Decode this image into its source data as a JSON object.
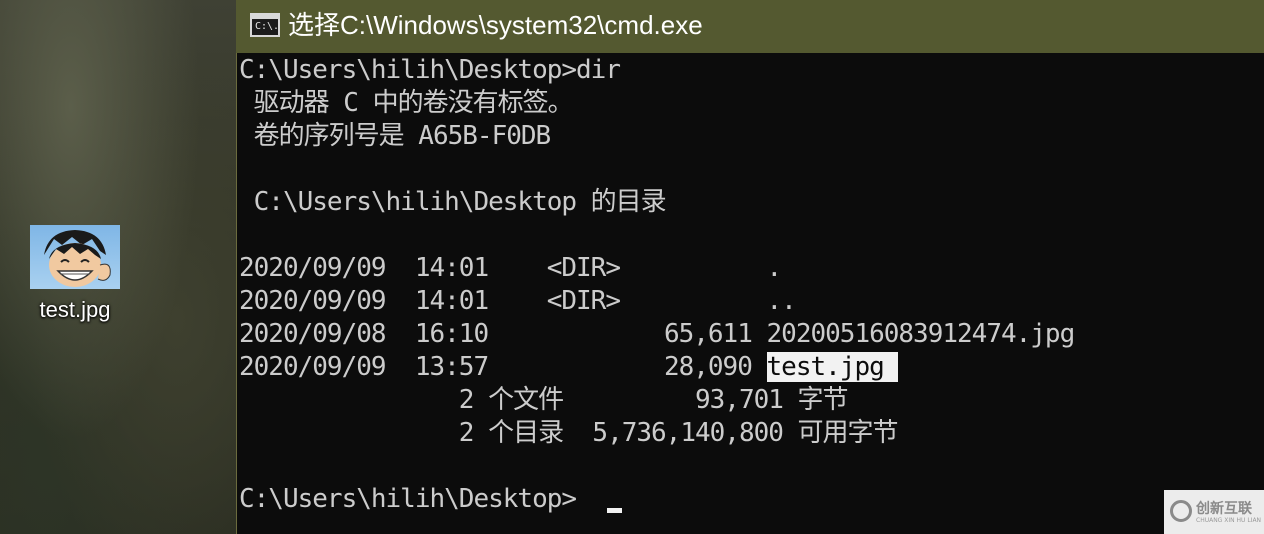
{
  "desktop": {
    "icon_label": "test.jpg"
  },
  "window": {
    "title": "选择C:\\Windows\\system32\\cmd.exe",
    "icon_glyph": "C:\\."
  },
  "console": {
    "lines": [
      "C:\\Users\\hilih\\Desktop>dir",
      " 驱动器 C 中的卷没有标签。",
      " 卷的序列号是 A65B-F0DB",
      "",
      " C:\\Users\\hilih\\Desktop 的目录",
      "",
      "2020/09/09  14:01    <DIR>          .",
      "2020/09/09  14:01    <DIR>          ..",
      "2020/09/08  16:10            65,611 20200516083912474.jpg",
      "2020/09/09  13:57            28,090 ",
      "               2 个文件         93,701 字节",
      "               2 个目录  5,736,140,800 可用字节",
      "",
      "C:\\Users\\hilih\\Desktop>"
    ],
    "selected_text": "test.jpg "
  },
  "watermark": {
    "text": "创新互联",
    "sub": "CHUANG XIN HU LIAN"
  },
  "colors": {
    "titlebar": "#545930",
    "console_bg": "#0c0c0c",
    "console_fg": "#cccccc"
  }
}
